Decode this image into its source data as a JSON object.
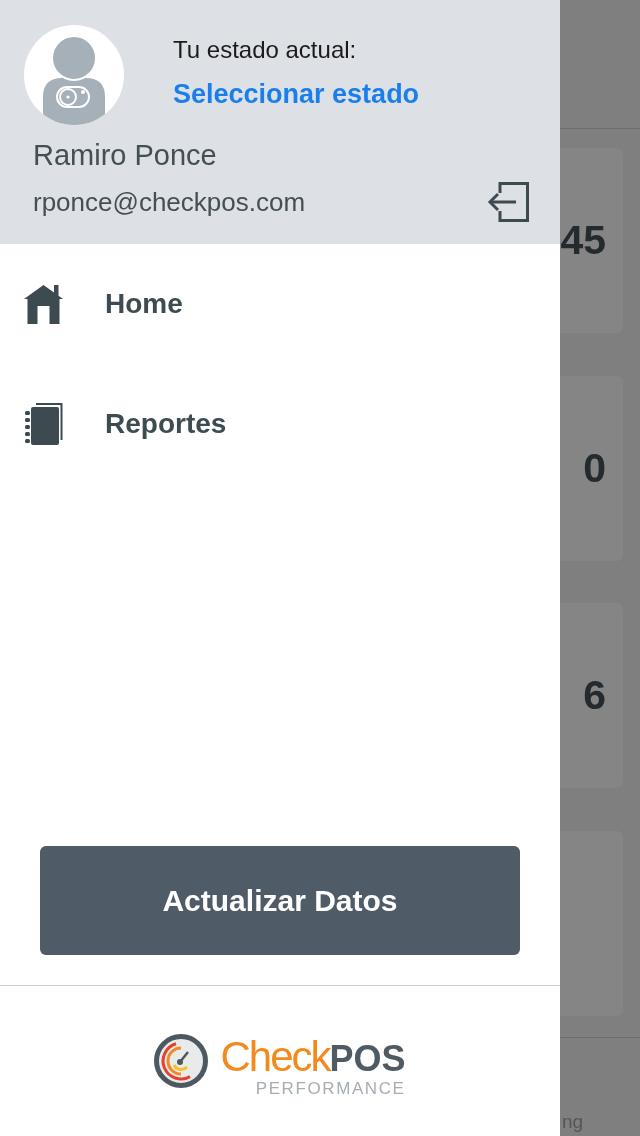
{
  "drawer": {
    "header": {
      "status_label": "Tu estado actual:",
      "status_link": "Seleccionar estado",
      "user_name": "Ramiro Ponce",
      "user_email": "rponce@checkpos.com"
    },
    "menu": [
      {
        "kind": "home",
        "label": "Home"
      },
      {
        "kind": "reports",
        "label": "Reportes"
      }
    ],
    "update_button": "Actualizar Datos",
    "brand": {
      "wordmark": "Check**POS**",
      "tagline": "PERFORMANCE"
    }
  },
  "background": {
    "cards": [
      {
        "kind": "number",
        "value": "45"
      },
      {
        "kind": "number",
        "value": "0"
      },
      {
        "kind": "number",
        "value": "6"
      },
      {
        "kind": "blank"
      }
    ],
    "footer_text": "ng"
  }
}
